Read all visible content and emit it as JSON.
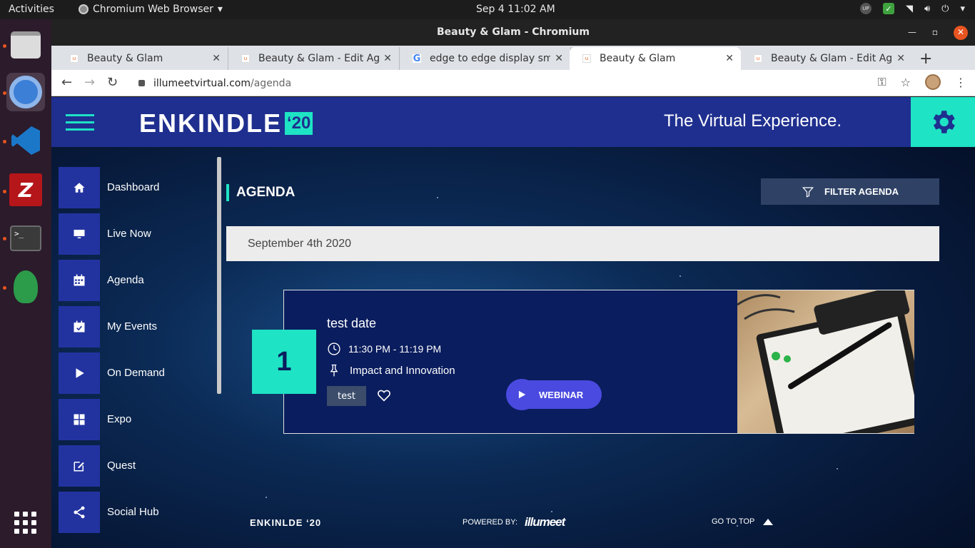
{
  "os": {
    "activities": "Activities",
    "app_menu": "Chromium Web Browser",
    "clock": "Sep 4  11:02 AM",
    "tray_badge": "UP"
  },
  "window": {
    "title": "Beauty & Glam - Chromium"
  },
  "tabs": [
    {
      "label": "Beauty & Glam",
      "favicon": "u"
    },
    {
      "label": "Beauty & Glam - Edit Agen",
      "favicon": "u"
    },
    {
      "label": "edge to edge display sma",
      "favicon": "G"
    },
    {
      "label": "Beauty & Glam",
      "favicon": "u"
    },
    {
      "label": "Beauty & Glam - Edit Agen",
      "favicon": "u"
    }
  ],
  "address": {
    "domain": "illumeetvirtual.com",
    "path": "/agenda"
  },
  "site": {
    "logo": "ENKINDLE",
    "logo_year": "‘20",
    "tagline": "The Virtual Experience.",
    "accent_color": "#1ee3c4",
    "header_color": "#1f2f8f"
  },
  "nav": [
    {
      "label": "Dashboard",
      "icon": "home-icon"
    },
    {
      "label": "Live Now",
      "icon": "monitor-icon"
    },
    {
      "label": "Agenda",
      "icon": "calendar-grid-icon"
    },
    {
      "label": "My Events",
      "icon": "calendar-check-icon"
    },
    {
      "label": "On Demand",
      "icon": "play-icon"
    },
    {
      "label": "Expo",
      "icon": "apps-grid-icon"
    },
    {
      "label": "Quest",
      "icon": "edit-icon"
    },
    {
      "label": "Social Hub",
      "icon": "share-icon"
    }
  ],
  "agenda": {
    "title": "AGENDA",
    "filter_label": "FILTER AGENDA",
    "date": "September 4th 2020",
    "session": {
      "number": "1",
      "title": "test date",
      "time": "11:30 PM - 11:19 PM",
      "track": "Impact and Innovation",
      "tag": "test",
      "type": "WEBINAR"
    }
  },
  "footer": {
    "brand": "ENKINLDE ‘20",
    "powered_by": "POWERED BY:",
    "powered_logo": "illumeet",
    "go_top": "GO TO TOP"
  }
}
